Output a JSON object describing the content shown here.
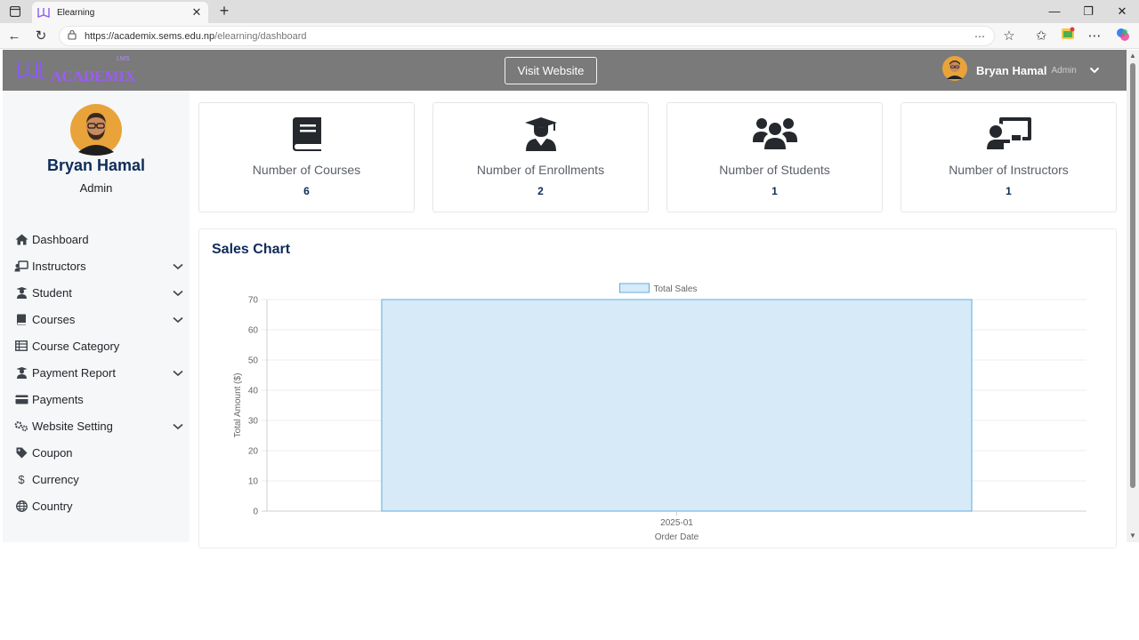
{
  "browser": {
    "tab_title": "Elearning",
    "url_host": "https://academix.sems.edu.np",
    "url_path": "/elearning/dashboard",
    "new_tab": "+",
    "close_tab": "✕"
  },
  "header": {
    "logo_text": "ACADEMIX",
    "logo_sup": "LMS",
    "visit_button": "Visit Website",
    "user_name": "Bryan Hamal",
    "user_role": "Admin"
  },
  "sidebar": {
    "profile_name": "Bryan Hamal",
    "profile_role": "Admin",
    "items": [
      {
        "label": "Dashboard",
        "icon": "home-icon",
        "has_submenu": false
      },
      {
        "label": "Instructors",
        "icon": "chalkboard-teacher-icon",
        "has_submenu": true
      },
      {
        "label": "Student",
        "icon": "user-graduate-icon",
        "has_submenu": true
      },
      {
        "label": "Courses",
        "icon": "book-icon",
        "has_submenu": true
      },
      {
        "label": "Course Category",
        "icon": "table-list-icon",
        "has_submenu": false
      },
      {
        "label": "Payment Report",
        "icon": "user-graduate-icon",
        "has_submenu": true
      },
      {
        "label": "Payments",
        "icon": "credit-card-icon",
        "has_submenu": false
      },
      {
        "label": "Website Setting",
        "icon": "cogs-icon",
        "has_submenu": true
      },
      {
        "label": "Coupon",
        "icon": "tag-icon",
        "has_submenu": false
      },
      {
        "label": "Currency",
        "icon": "dollar-icon",
        "has_submenu": false
      },
      {
        "label": "Country",
        "icon": "globe-icon",
        "has_submenu": false
      }
    ]
  },
  "stats": [
    {
      "label": "Number of Courses",
      "value": "6",
      "icon": "book-icon"
    },
    {
      "label": "Number of Enrollments",
      "value": "2",
      "icon": "user-graduate-icon"
    },
    {
      "label": "Number of Students",
      "value": "1",
      "icon": "users-icon"
    },
    {
      "label": "Number of Instructors",
      "value": "1",
      "icon": "chalkboard-teacher-icon"
    }
  ],
  "sales_chart": {
    "title": "Sales Chart"
  },
  "chart_data": {
    "type": "bar",
    "categories": [
      "2025-01"
    ],
    "series": [
      {
        "name": "Total Sales",
        "values": [
          70
        ]
      }
    ],
    "xlabel": "Order Date",
    "ylabel": "Total Amount ($)",
    "ylim": [
      0,
      70
    ],
    "yticks": [
      0,
      10,
      20,
      30,
      40,
      50,
      60,
      70
    ],
    "grid": true,
    "legend": "top-center",
    "bar_fill": "#d6eaf8",
    "bar_stroke": "#5dade2"
  },
  "colors": {
    "header_bg": "#7a7a7a",
    "accent_navy": "#0f2c59",
    "logo_purple": "#8b5cf6"
  }
}
